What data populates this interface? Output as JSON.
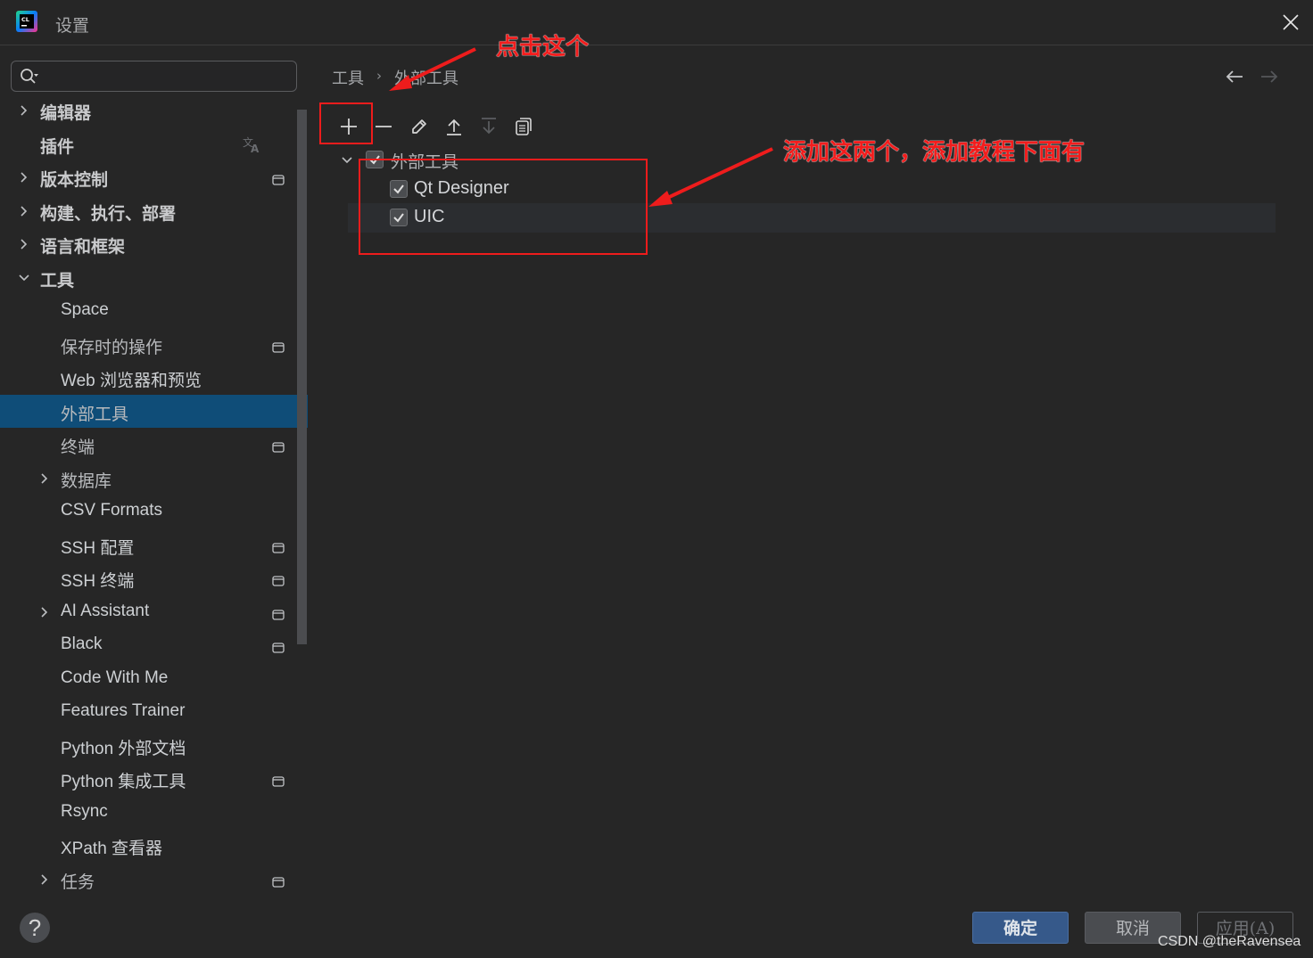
{
  "window": {
    "title": "设置",
    "app_icon": "clion-logo-icon",
    "close_icon": "close-icon"
  },
  "sidebar": {
    "search": {
      "value": "",
      "placeholder": ""
    },
    "items": [
      {
        "label": "编辑器",
        "level": 0,
        "expandable": true,
        "expanded": false,
        "badge": null
      },
      {
        "label": "插件",
        "level": 0,
        "expandable": false,
        "badge": "translate-icon"
      },
      {
        "label": "版本控制",
        "level": 0,
        "expandable": true,
        "expanded": false,
        "badge": "project-icon"
      },
      {
        "label": "构建、执行、部署",
        "level": 0,
        "expandable": true,
        "expanded": false,
        "badge": null
      },
      {
        "label": "语言和框架",
        "level": 0,
        "expandable": true,
        "expanded": false,
        "badge": null
      },
      {
        "label": "工具",
        "level": 0,
        "expandable": true,
        "expanded": true,
        "badge": null
      },
      {
        "label": "Space",
        "level": 1,
        "expandable": false,
        "badge": null
      },
      {
        "label": "保存时的操作",
        "level": 1,
        "expandable": false,
        "badge": "project-icon"
      },
      {
        "label": "Web 浏览器和预览",
        "level": 1,
        "expandable": false,
        "badge": null
      },
      {
        "label": "外部工具",
        "level": 1,
        "expandable": false,
        "badge": null,
        "selected": true
      },
      {
        "label": "终端",
        "level": 1,
        "expandable": false,
        "badge": "project-icon"
      },
      {
        "label": "数据库",
        "level": 1,
        "expandable": true,
        "expanded": false,
        "badge": null
      },
      {
        "label": "CSV Formats",
        "level": 1,
        "expandable": false,
        "badge": null
      },
      {
        "label": "SSH 配置",
        "level": 1,
        "expandable": false,
        "badge": "project-icon"
      },
      {
        "label": "SSH 终端",
        "level": 1,
        "expandable": false,
        "badge": "project-icon"
      },
      {
        "label": "AI Assistant",
        "level": 1,
        "expandable": true,
        "expanded": false,
        "badge": "project-icon"
      },
      {
        "label": "Black",
        "level": 1,
        "expandable": false,
        "badge": "project-icon"
      },
      {
        "label": "Code With Me",
        "level": 1,
        "expandable": false,
        "badge": null
      },
      {
        "label": "Features Trainer",
        "level": 1,
        "expandable": false,
        "badge": null
      },
      {
        "label": "Python 外部文档",
        "level": 1,
        "expandable": false,
        "badge": null
      },
      {
        "label": "Python 集成工具",
        "level": 1,
        "expandable": false,
        "badge": "project-icon"
      },
      {
        "label": "Rsync",
        "level": 1,
        "expandable": false,
        "badge": null
      },
      {
        "label": "XPath 查看器",
        "level": 1,
        "expandable": false,
        "badge": null
      },
      {
        "label": "任务",
        "level": 1,
        "expandable": true,
        "expanded": false,
        "badge": "project-icon"
      }
    ],
    "help_label": "?"
  },
  "main": {
    "breadcrumb": [
      "工具",
      "外部工具"
    ],
    "breadcrumb_separator": "›",
    "toolbar": [
      {
        "name": "add",
        "icon": "plus-icon",
        "enabled": true
      },
      {
        "name": "remove",
        "icon": "minus-icon",
        "enabled": true
      },
      {
        "name": "edit",
        "icon": "pencil-icon",
        "enabled": true
      },
      {
        "name": "move-up",
        "icon": "move-up-icon",
        "enabled": true
      },
      {
        "name": "move-down",
        "icon": "move-down-icon",
        "enabled": false
      },
      {
        "name": "copy",
        "icon": "copy-icon",
        "enabled": true
      }
    ],
    "tree": {
      "group": {
        "label": "外部工具",
        "checked": true,
        "expanded": true
      },
      "tools": [
        {
          "label": "Qt Designer",
          "checked": true
        },
        {
          "label": "UIC",
          "checked": true
        }
      ]
    }
  },
  "footer": {
    "ok_label": "确定",
    "cancel_label": "取消",
    "apply_label": "应用(A)"
  },
  "annotations": {
    "click_this": "点击这个",
    "add_these_two": "添加这两个，添加教程下面有",
    "color": "#f21d1d"
  },
  "watermark": "CSDN @theRavensea"
}
